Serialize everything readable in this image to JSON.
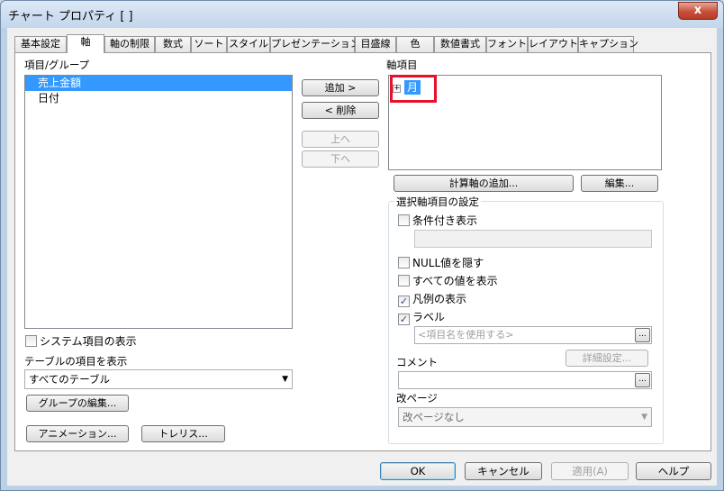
{
  "window": {
    "title": "チャート プロパティ [ ]",
    "close_label": "x"
  },
  "tabs": [
    {
      "label": "基本設定"
    },
    {
      "label": "軸"
    },
    {
      "label": "軸の制限"
    },
    {
      "label": "数式"
    },
    {
      "label": "ソート"
    },
    {
      "label": "スタイル"
    },
    {
      "label": "プレゼンテーション"
    },
    {
      "label": "目盛線"
    },
    {
      "label": "色"
    },
    {
      "label": "数値書式"
    },
    {
      "label": "フォント"
    },
    {
      "label": "レイアウト"
    },
    {
      "label": "キャプション"
    }
  ],
  "active_tab": "軸",
  "left": {
    "items_label": "項目/グループ",
    "items": [
      {
        "label": "売上金額",
        "selected": true
      },
      {
        "label": "日付",
        "selected": false
      }
    ],
    "show_system_fields": {
      "label": "システム項目の表示",
      "checked": false
    },
    "show_table_fields_label": "テーブルの項目を表示",
    "table_select_value": "すべてのテーブル",
    "edit_groups_label": "グループの編集...",
    "animation_label": "アニメーション...",
    "trellis_label": "トレリス..."
  },
  "middle": {
    "add_label": "追加 >",
    "remove_label": "< 削除",
    "up_label": "上へ",
    "down_label": "下へ"
  },
  "right": {
    "axis_items_label": "軸項目",
    "axis_items": [
      {
        "label": "月",
        "expander": "+"
      }
    ],
    "add_calculated_label": "計算軸の追加...",
    "edit_label": "編集...",
    "settings_group_title": "選択軸項目の設定",
    "conditional": {
      "label": "条件付き表示",
      "checked": false
    },
    "suppress_null": {
      "label": "NULL値を隠す",
      "checked": false
    },
    "show_all_values": {
      "label": "すべての値を表示",
      "checked": false
    },
    "show_in_legend": {
      "label": "凡例の表示",
      "checked": true
    },
    "label_cb": {
      "label": "ラベル",
      "checked": true
    },
    "label_placeholder": "<項目名を使用する>",
    "ellipsis": "...",
    "advanced_label": "詳細設定...",
    "comment_label": "コメント",
    "page_break_label": "改ページ",
    "page_break_value": "改ページなし"
  },
  "footer": {
    "ok_label": "OK",
    "cancel_label": "キャンセル",
    "apply_label": "適用(A)",
    "help_label": "ヘルプ"
  },
  "colors": {
    "selection": "#3399ff",
    "highlight_box": "#e8102a",
    "window_frame": "#bcd0e6"
  }
}
